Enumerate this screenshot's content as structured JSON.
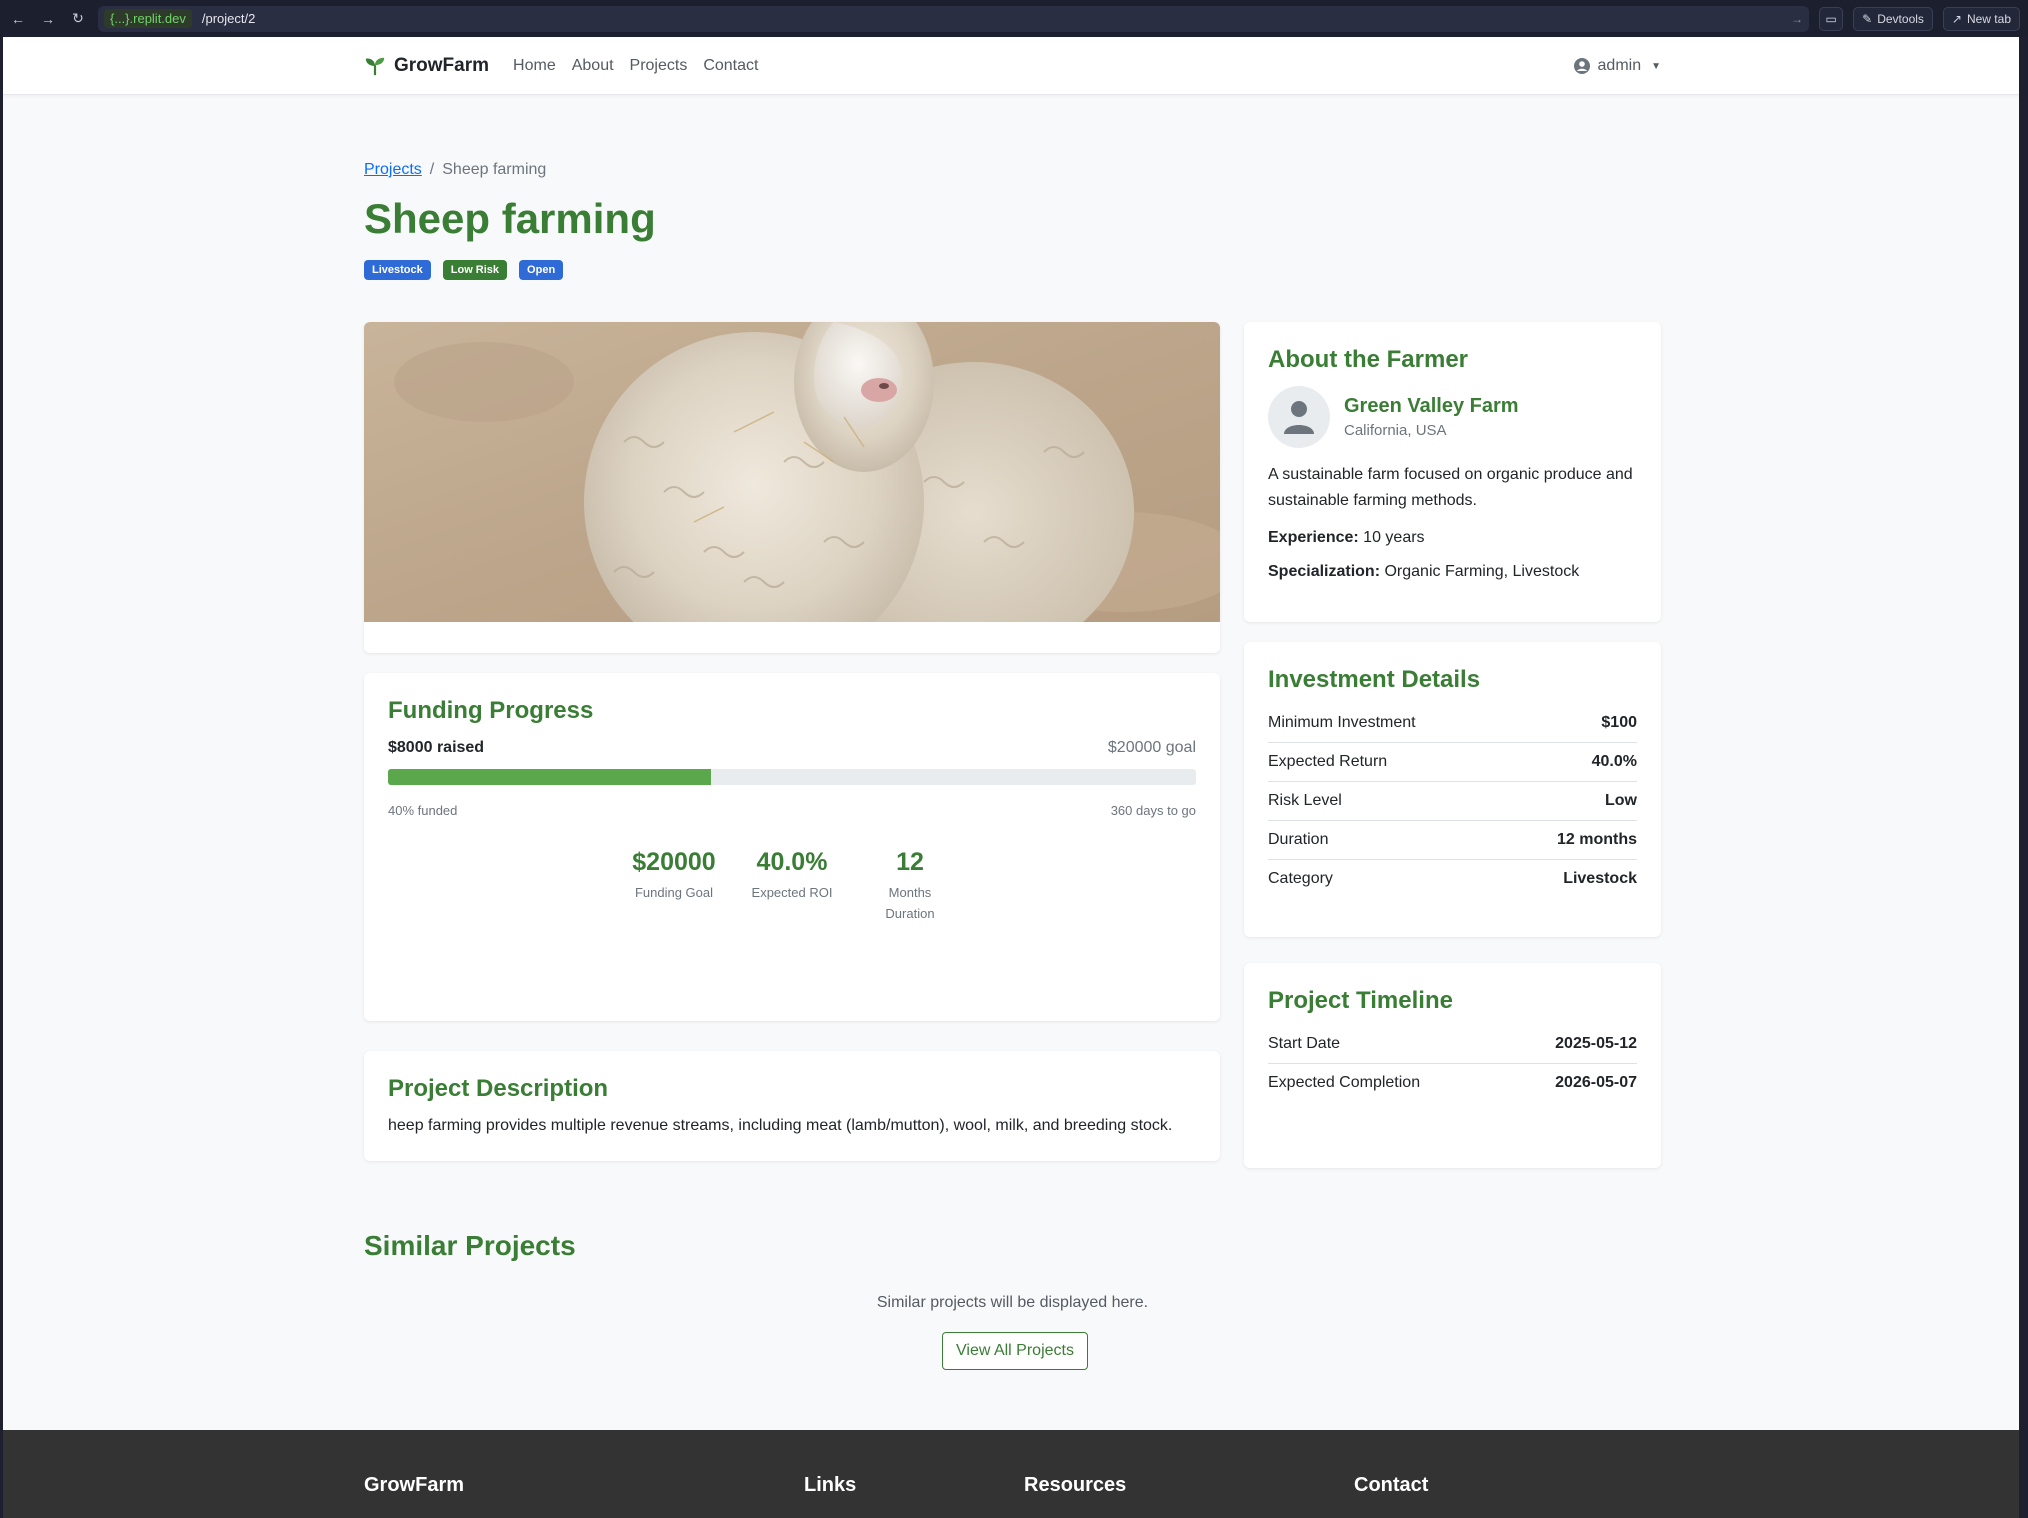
{
  "browser": {
    "host": "{...}.replit.dev",
    "path": "/project/2",
    "devtools_label": "Devtools",
    "newtab_label": "New tab"
  },
  "navbar": {
    "brand": "GrowFarm",
    "links": [
      "Home",
      "About",
      "Projects",
      "Contact"
    ],
    "user": "admin"
  },
  "breadcrumb": {
    "parent": "Projects",
    "separator": "/",
    "current": "Sheep farming"
  },
  "project": {
    "title": "Sheep farming",
    "badges": [
      {
        "label": "Livestock",
        "color": "#2f6bd6"
      },
      {
        "label": "Low Risk",
        "color": "#3a7d35"
      },
      {
        "label": "Open",
        "color": "#2f6bd6"
      }
    ]
  },
  "funding": {
    "heading": "Funding Progress",
    "raised": "$8000 raised",
    "goal": "$20000 goal",
    "percent": 40,
    "funded_label": "40% funded",
    "days_label": "360 days to go",
    "stats": [
      {
        "value": "$20000",
        "label": "Funding Goal"
      },
      {
        "value": "40.0%",
        "label": "Expected ROI"
      },
      {
        "value": "12",
        "label": "Months Duration"
      }
    ]
  },
  "description": {
    "heading": "Project Description",
    "text": "heep farming provides multiple revenue streams, including meat (lamb/mutton), wool, milk, and breeding stock."
  },
  "farmer": {
    "heading": "About the Farmer",
    "name": "Green Valley Farm",
    "location": "California, USA",
    "bio": "A sustainable farm focused on organic produce and sustainable farming methods.",
    "experience_label": "Experience:",
    "experience": "10 years",
    "specialization_label": "Specialization:",
    "specialization": "Organic Farming, Livestock"
  },
  "investment": {
    "heading": "Investment Details",
    "rows": [
      {
        "k": "Minimum Investment",
        "v": "$100"
      },
      {
        "k": "Expected Return",
        "v": "40.0%"
      },
      {
        "k": "Risk Level",
        "v": "Low"
      },
      {
        "k": "Duration",
        "v": "12 months"
      },
      {
        "k": "Category",
        "v": "Livestock"
      }
    ]
  },
  "timeline": {
    "heading": "Project Timeline",
    "rows": [
      {
        "k": "Start Date",
        "v": "2025-05-12"
      },
      {
        "k": "Expected Completion",
        "v": "2026-05-07"
      }
    ]
  },
  "similar": {
    "heading": "Similar Projects",
    "placeholder": "Similar projects will be displayed here.",
    "button": "View All Projects"
  },
  "footer": {
    "columns": [
      "GrowFarm",
      "Links",
      "Resources",
      "Contact"
    ]
  },
  "colors": {
    "brand_green": "#3a7d35",
    "progress_green": "#5aa84b",
    "badge_blue": "#2f6bd6",
    "footer_bg": "#333333"
  }
}
